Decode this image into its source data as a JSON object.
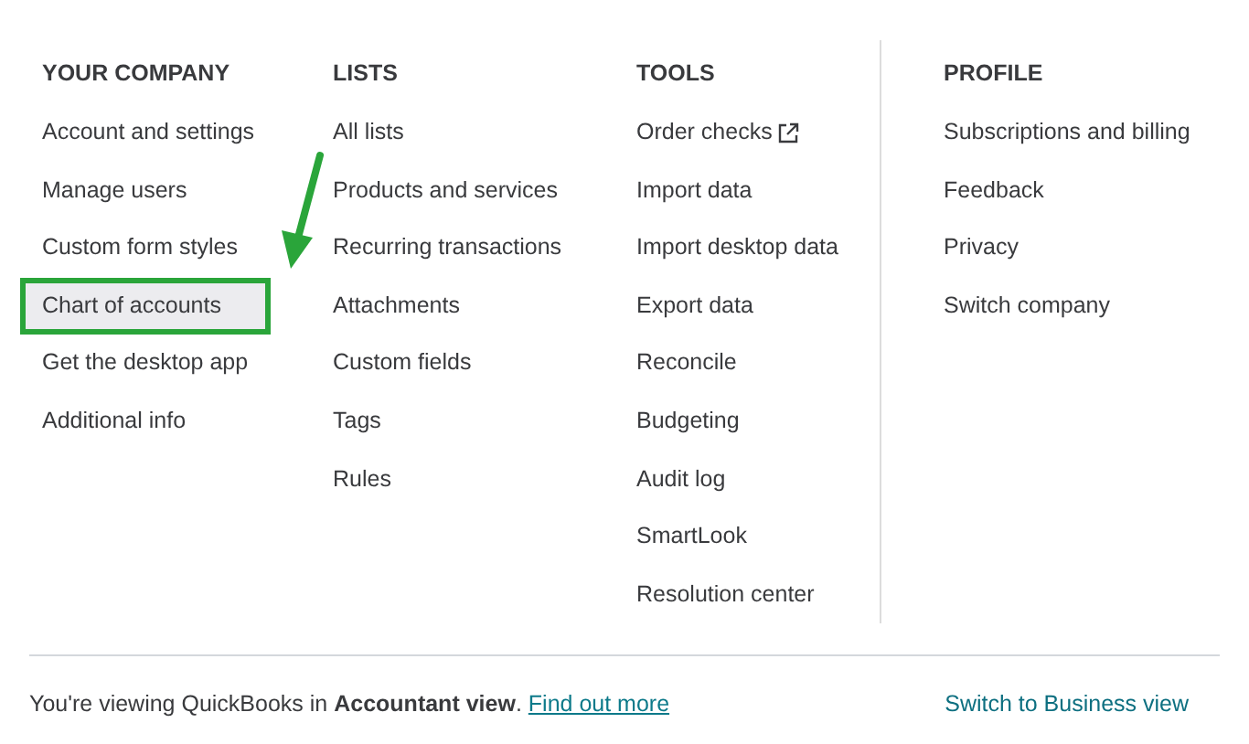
{
  "columns": [
    {
      "heading": "YOUR COMPANY",
      "items": [
        {
          "label": "Account and settings",
          "selected": false
        },
        {
          "label": "Manage users",
          "selected": false
        },
        {
          "label": "Custom form styles",
          "selected": false
        },
        {
          "label": "Chart of accounts",
          "selected": true
        },
        {
          "label": "Get the desktop app",
          "selected": false
        },
        {
          "label": "Additional info",
          "selected": false
        }
      ]
    },
    {
      "heading": "LISTS",
      "items": [
        {
          "label": "All lists",
          "selected": false
        },
        {
          "label": "Products and services",
          "selected": false
        },
        {
          "label": "Recurring transactions",
          "selected": false
        },
        {
          "label": "Attachments",
          "selected": false
        },
        {
          "label": "Custom fields",
          "selected": false
        },
        {
          "label": "Tags",
          "selected": false
        },
        {
          "label": "Rules",
          "selected": false
        }
      ]
    },
    {
      "heading": "TOOLS",
      "items": [
        {
          "label": "Order checks",
          "selected": false,
          "kind": "external"
        },
        {
          "label": "Import data",
          "selected": false
        },
        {
          "label": "Import desktop data",
          "selected": false
        },
        {
          "label": "Export data",
          "selected": false
        },
        {
          "label": "Reconcile",
          "selected": false
        },
        {
          "label": "Budgeting",
          "selected": false
        },
        {
          "label": "Audit log",
          "selected": false
        },
        {
          "label": "SmartLook",
          "selected": false
        },
        {
          "label": "Resolution center",
          "selected": false
        }
      ]
    },
    {
      "heading": "PROFILE",
      "items": [
        {
          "label": "Subscriptions and billing",
          "selected": false
        },
        {
          "label": "Feedback",
          "selected": false
        },
        {
          "label": "Privacy",
          "selected": false
        },
        {
          "label": "Switch company",
          "selected": false
        }
      ]
    }
  ],
  "footer": {
    "message": "You're viewing QuickBooks in **Accountant view**.",
    "link": "Find out more",
    "switch_link": "Switch to Business view"
  }
}
